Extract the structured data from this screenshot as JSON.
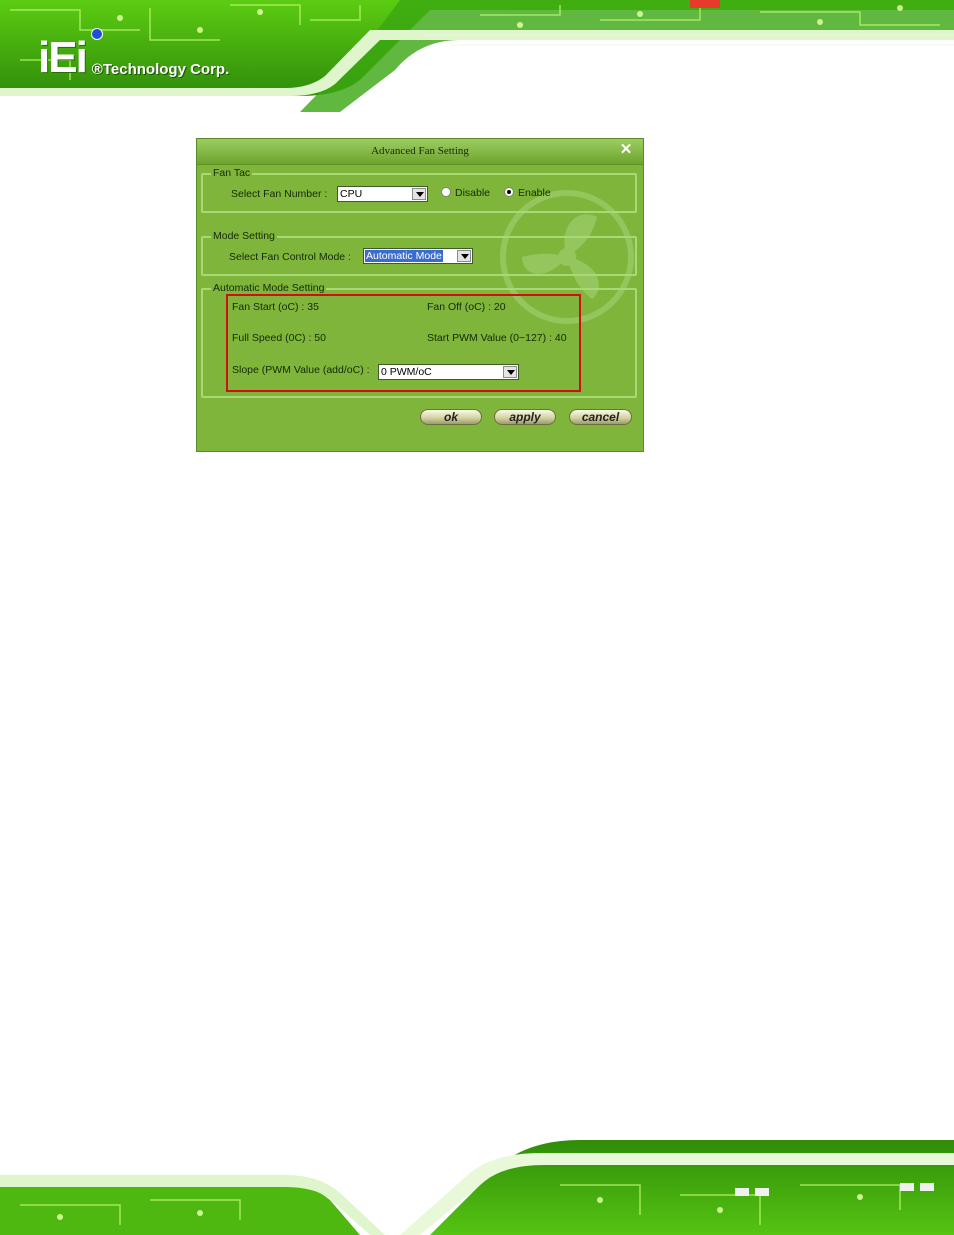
{
  "header": {
    "logo_mark": "iEi",
    "company": "®Technology Corp."
  },
  "dialog": {
    "title": "Advanced Fan Setting",
    "close_glyph": "✕",
    "fan_tac": {
      "group_label": "Fan Tac",
      "select_label": "Select Fan Number :",
      "fan_number": "CPU",
      "disable_label": "Disable",
      "enable_label": "Enable",
      "selected": "Enable"
    },
    "mode_setting": {
      "group_label": "Mode Setting",
      "select_label": "Select Fan Control Mode :",
      "mode": "Automatic Mode"
    },
    "automatic": {
      "group_label": "Automatic Mode Setting",
      "fan_start": "Fan Start (oC) :  35",
      "fan_off": "Fan Off (oC) :  20",
      "full_speed": "Full Speed (0C) : 50",
      "start_pwm": "Start PWM Value (0~127) : 40",
      "slope_label": "Slope (PWM Value (add/oC) :",
      "slope_value": "0 PWM/oC"
    },
    "buttons": {
      "ok": "ok",
      "apply": "apply",
      "cancel": "cancel"
    }
  },
  "colors": {
    "dialog_bg": "#7fb53a",
    "highlight": "#d01010",
    "banner_green": "#5fc21a"
  }
}
